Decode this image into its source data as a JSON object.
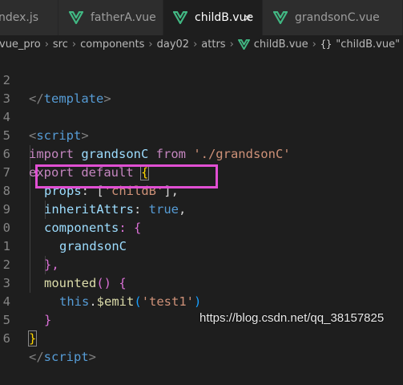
{
  "tabs": [
    {
      "label": "ndex.js",
      "active": false,
      "icon": "js-file-icon"
    },
    {
      "label": "fatherA.vue",
      "active": false,
      "icon": "vue-icon"
    },
    {
      "label": "childB.vue",
      "active": true,
      "icon": "vue-icon",
      "close": "×"
    },
    {
      "label": "grandsonC.vue",
      "active": false,
      "icon": "vue-icon"
    }
  ],
  "breadcrumb": {
    "items": [
      "vue_pro",
      "src",
      "components",
      "day02",
      "attrs",
      "childB.vue",
      "\"childB.vue\"",
      "sc"
    ],
    "separator": "›",
    "braces_icon": "{}"
  },
  "editor": {
    "lines": [
      {
        "n": "2"
      },
      {
        "n": "3"
      },
      {
        "n": "4"
      },
      {
        "n": "5"
      },
      {
        "n": "6"
      },
      {
        "n": "7"
      },
      {
        "n": "8"
      },
      {
        "n": "9"
      },
      {
        "n": "0"
      },
      {
        "n": "1"
      },
      {
        "n": "2"
      },
      {
        "n": "3"
      },
      {
        "n": "4"
      },
      {
        "n": "5"
      },
      {
        "n": "6"
      }
    ],
    "tokens": {
      "l2_close": "</",
      "l2_name": "template",
      "l2_end": ">",
      "l4_open": "<",
      "l4_name": "script",
      "l4_end": ">",
      "l5_import": "import",
      "l5_ident": " grandsonC ",
      "l5_from": "from",
      "l5_str": " './grandsonC'",
      "l6_export": "export",
      "l6_default": " default",
      "l6_brace": "{",
      "l7_prop": "props",
      "l7_colon": ": [",
      "l7_str": "'childB'",
      "l7_end": "],",
      "l8_prop": "inheritAttrs",
      "l8_colon": ": ",
      "l8_bool": "true",
      "l8_end": ",",
      "l9_prop": "components",
      "l9_colon": ": {",
      "l10_ident": "grandsonC",
      "l11_end": "},",
      "l12_fn": "mounted",
      "l12_paren": "() {",
      "l13_this": "this",
      "l13_dot": ".",
      "l13_fn": "$emit",
      "l13_paren": "(",
      "l13_str": "'test1'",
      "l13_close": ")",
      "l14_close": "}",
      "l15_brace": "}",
      "l16_close": "</",
      "l16_name": "script",
      "l16_end": ">"
    }
  },
  "watermark": "https://blog.csdn.net/qq_38157825",
  "colors": {
    "background": "#1e1e1e",
    "highlight_box": "#e14fd3",
    "vue_icon": "#41b883"
  }
}
